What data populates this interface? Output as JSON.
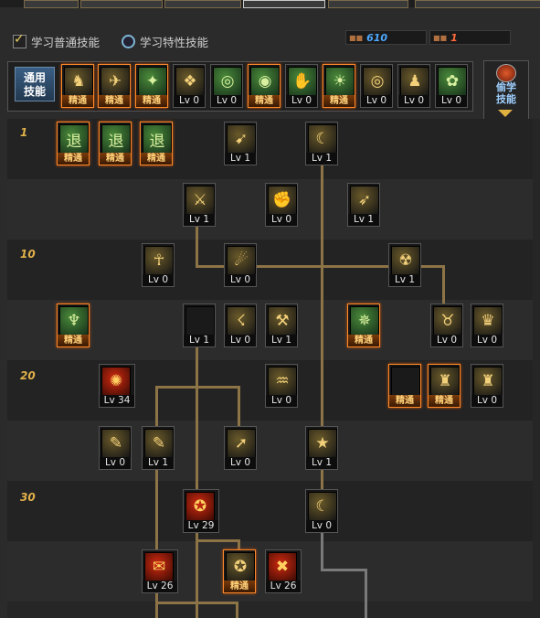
{
  "options": {
    "normal_label": "学习普通技能",
    "special_label": "学习特性技能"
  },
  "sp": {
    "normal": "610",
    "special": "1"
  },
  "category_label_line1": "通用",
  "category_label_line2": "技能",
  "side_button": {
    "line1": "偷学",
    "line2": "技能"
  },
  "common_skills": [
    {
      "label": "精通",
      "glyph": "♞",
      "tone": "yellow",
      "master": true
    },
    {
      "label": "精通",
      "glyph": "✈",
      "tone": "yellow",
      "master": true
    },
    {
      "label": "精通",
      "glyph": "✦",
      "tone": "green",
      "master": true
    },
    {
      "label": "Lv 0",
      "glyph": "❖",
      "tone": "yellow",
      "master": false
    },
    {
      "label": "Lv 0",
      "glyph": "◎",
      "tone": "green",
      "master": false
    },
    {
      "label": "精通",
      "glyph": "◉",
      "tone": "green",
      "master": true
    },
    {
      "label": "Lv 0",
      "glyph": "✋",
      "tone": "green",
      "master": false
    },
    {
      "label": "精通",
      "glyph": "☀",
      "tone": "green",
      "master": true
    },
    {
      "label": "Lv 0",
      "glyph": "◎",
      "tone": "yellow",
      "master": false
    },
    {
      "label": "Lv 0",
      "glyph": "♟",
      "tone": "yellow",
      "master": false
    },
    {
      "label": "Lv 0",
      "glyph": "✿",
      "tone": "green",
      "master": false
    }
  ],
  "level_labels": [
    "1",
    "10",
    "20",
    "30"
  ],
  "tree_skills": [
    {
      "label": "精通",
      "glyph": "退",
      "tone": "green",
      "master": true
    },
    {
      "label": "精通",
      "glyph": "退",
      "tone": "green",
      "master": true
    },
    {
      "label": "精通",
      "glyph": "退",
      "tone": "green",
      "master": true
    },
    {
      "label": "Lv 1",
      "glyph": "➹",
      "tone": "yellow",
      "master": false
    },
    {
      "label": "Lv 1",
      "glyph": "☾",
      "tone": "yellow",
      "master": false
    },
    {
      "label": "Lv 1",
      "glyph": "⚔",
      "tone": "yellow",
      "master": false
    },
    {
      "label": "Lv 0",
      "glyph": "✊",
      "tone": "yellow",
      "master": false
    },
    {
      "label": "Lv 1",
      "glyph": "➶",
      "tone": "yellow",
      "master": false
    },
    {
      "label": "Lv 0",
      "glyph": "☥",
      "tone": "yellow",
      "master": false
    },
    {
      "label": "Lv 0",
      "glyph": "☄",
      "tone": "yellow",
      "master": false
    },
    {
      "label": "Lv 1",
      "glyph": "☢",
      "tone": "yellow",
      "master": false
    },
    {
      "label": "精通",
      "glyph": "♆",
      "tone": "green",
      "master": true
    },
    {
      "label": "Lv 1",
      "glyph": "",
      "tone": "dark",
      "master": false
    },
    {
      "label": "Lv 0",
      "glyph": "☇",
      "tone": "yellow",
      "master": false
    },
    {
      "label": "Lv 1",
      "glyph": "⚒",
      "tone": "yellow",
      "master": false
    },
    {
      "label": "精通",
      "glyph": "✵",
      "tone": "green",
      "master": true
    },
    {
      "label": "Lv 0",
      "glyph": "♉",
      "tone": "yellow",
      "master": false
    },
    {
      "label": "Lv 0",
      "glyph": "♛",
      "tone": "yellow",
      "master": false
    },
    {
      "label": "Lv 34",
      "glyph": "✺",
      "tone": "red",
      "master": false
    },
    {
      "label": "Lv 0",
      "glyph": "♒",
      "tone": "yellow",
      "master": false
    },
    {
      "label": "精通",
      "glyph": "",
      "tone": "dark",
      "master": true
    },
    {
      "label": "精通",
      "glyph": "♜",
      "tone": "yellow",
      "master": true
    },
    {
      "label": "Lv 0",
      "glyph": "♜",
      "tone": "yellow",
      "master": false
    },
    {
      "label": "Lv 0",
      "glyph": "✎",
      "tone": "yellow",
      "master": false
    },
    {
      "label": "Lv 1",
      "glyph": "✎",
      "tone": "yellow",
      "master": false
    },
    {
      "label": "Lv 0",
      "glyph": "➚",
      "tone": "yellow",
      "master": false
    },
    {
      "label": "Lv 1",
      "glyph": "★",
      "tone": "yellow",
      "master": false
    },
    {
      "label": "Lv 29",
      "glyph": "✪",
      "tone": "red",
      "master": false
    },
    {
      "label": "Lv 0",
      "glyph": "☾",
      "tone": "yellow",
      "master": false
    },
    {
      "label": "Lv 26",
      "glyph": "✉",
      "tone": "red",
      "master": false
    },
    {
      "label": "精通",
      "glyph": "✪",
      "tone": "yellow",
      "master": true
    },
    {
      "label": "Lv 26",
      "glyph": "✖",
      "tone": "red",
      "master": false
    }
  ]
}
